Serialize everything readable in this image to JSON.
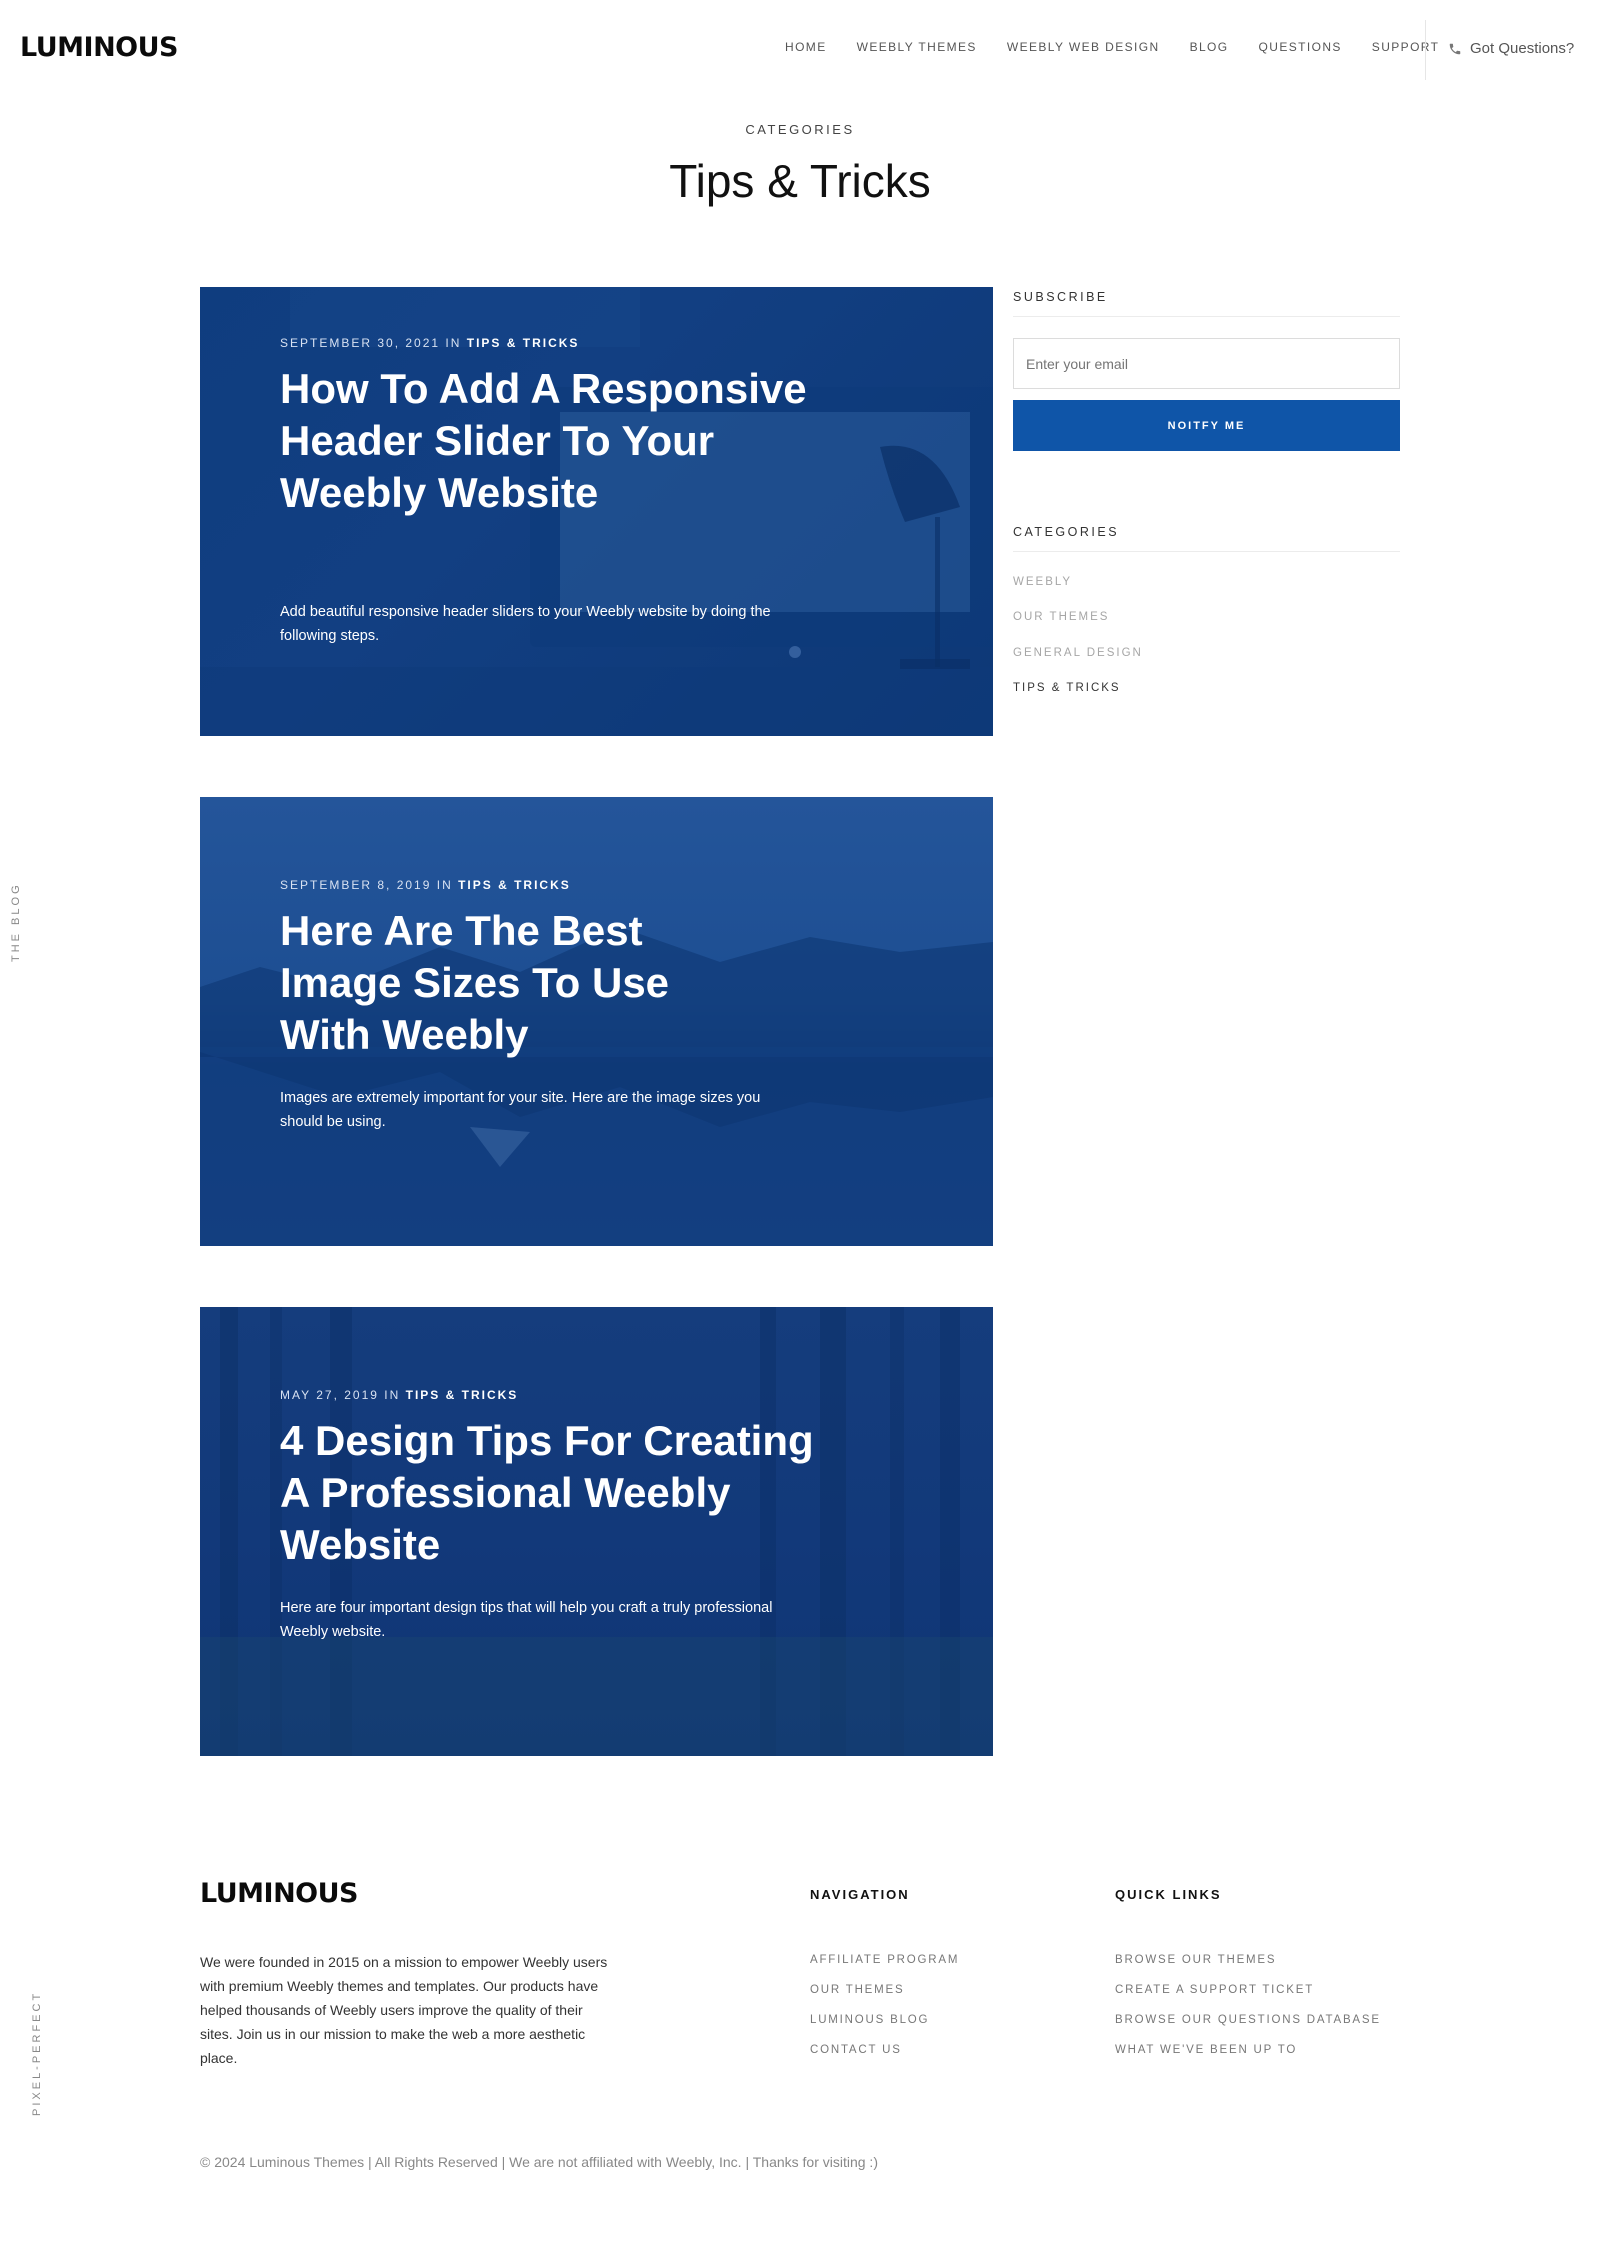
{
  "header": {
    "logo": "LUMINOUS",
    "nav": [
      "HOME",
      "WEEBLY THEMES",
      "WEEBLY WEB DESIGN",
      "BLOG",
      "QUESTIONS",
      "SUPPORT"
    ],
    "got_questions": "Got Questions?",
    "phone_icon": "phone-icon"
  },
  "side_labels": {
    "blog": "THE BLOG",
    "pixel": "PIXEL-PERFECT"
  },
  "page": {
    "eyebrow": "CATEGORIES",
    "title": "Tips & Tricks"
  },
  "posts": [
    {
      "date": "SEPTEMBER 30, 2021",
      "in": "IN",
      "category": "TIPS & TRICKS",
      "title": "How To Add A Responsive Header Slider To Your Weebly Website",
      "excerpt": "Add beautiful responsive header sliders to your Weebly website by doing the following steps."
    },
    {
      "date": "SEPTEMBER 8, 2019",
      "in": "IN",
      "category": "TIPS & TRICKS",
      "title": "Here Are The Best Image Sizes To Use With Weebly",
      "excerpt": "Images are extremely important for your site. Here are the image sizes you should be using."
    },
    {
      "date": "MAY 27, 2019",
      "in": "IN",
      "category": "TIPS & TRICKS",
      "title": "4 Design Tips For Creating A Professional Weebly Website",
      "excerpt": "Here are four important design tips that will help you craft a truly professional Weebly website."
    }
  ],
  "sidebar": {
    "subscribe_heading": "SUBSCRIBE",
    "email_placeholder": "Enter your email",
    "notify_label": "NOITFY ME",
    "categories_heading": "CATEGORIES",
    "categories": [
      "WEEBLY",
      "OUR THEMES",
      "GENERAL DESIGN",
      "TIPS & TRICKS"
    ],
    "button_color": "#0f55a8"
  },
  "footer": {
    "logo": "LUMINOUS",
    "about": "We were founded in 2015 on a mission to empower Weebly users with premium Weebly themes and templates. Our products have helped thousands of Weebly users improve the quality of their sites. Join us in our mission to make the web a more aesthetic place.",
    "navigation_heading": "NAVIGATION",
    "navigation": [
      "AFFILIATE PROGRAM",
      "OUR THEMES",
      "LUMINOUS BLOG",
      "CONTACT US"
    ],
    "quick_links_heading": "QUICK LINKS",
    "quick_links": [
      "BROWSE OUR THEMES",
      "CREATE A SUPPORT TICKET",
      "BROWSE OUR QUESTIONS DATABASE",
      "WHAT WE'VE BEEN UP TO"
    ],
    "copyright": "© 2024 Luminous Themes | All Rights Reserved | We are not affiliated with Weebly, Inc. | Thanks for visiting :)"
  }
}
